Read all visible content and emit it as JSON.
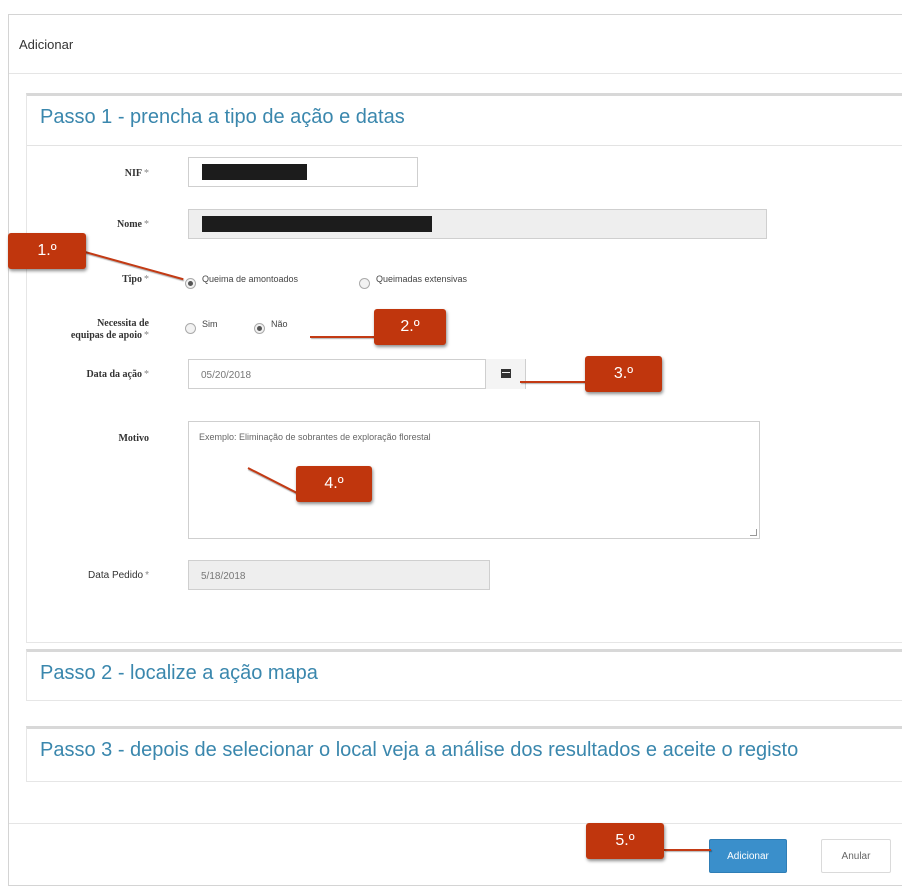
{
  "modal": {
    "title": "Adicionar"
  },
  "step1": {
    "heading": "Passo 1 - prencha a tipo de ação e datas",
    "nif": {
      "label": "NIF",
      "required": "*"
    },
    "nome": {
      "label": "Nome",
      "required": "*"
    },
    "tipo": {
      "label": "Tipo",
      "required": "*",
      "options": [
        {
          "label": "Queima de amontoados",
          "checked": true
        },
        {
          "label": "Queimadas extensivas",
          "checked": false
        }
      ]
    },
    "apoio": {
      "label_line1": "Necessita de",
      "label_line2": "equipas de apoio",
      "required": "*",
      "options": [
        {
          "label": "Sim",
          "checked": false
        },
        {
          "label": "Não",
          "checked": true
        }
      ]
    },
    "data_acao": {
      "label": "Data da ação",
      "required": "*",
      "value": "05/20/2018",
      "icon": "calendar-icon"
    },
    "motivo": {
      "label": "Motivo",
      "placeholder": "Exemplo: Eliminação de sobrantes de exploração florestal"
    },
    "data_pedido": {
      "label": "Data Pedido",
      "required": "*",
      "value": "5/18/2018"
    }
  },
  "step2": {
    "heading": "Passo 2 - localize a ação mapa"
  },
  "step3": {
    "heading": "Passo 3 - depois de selecionar o local veja a análise dos resultados e aceite o registo"
  },
  "footer": {
    "add_label": "Adicionar",
    "cancel_label": "Anular"
  },
  "callouts": [
    "1.º",
    "2.º",
    "3.º",
    "4.º",
    "5.º"
  ],
  "colors": {
    "accent": "#3a87ad",
    "primary_button": "#3a8fcb",
    "callout": "#c0360d"
  }
}
